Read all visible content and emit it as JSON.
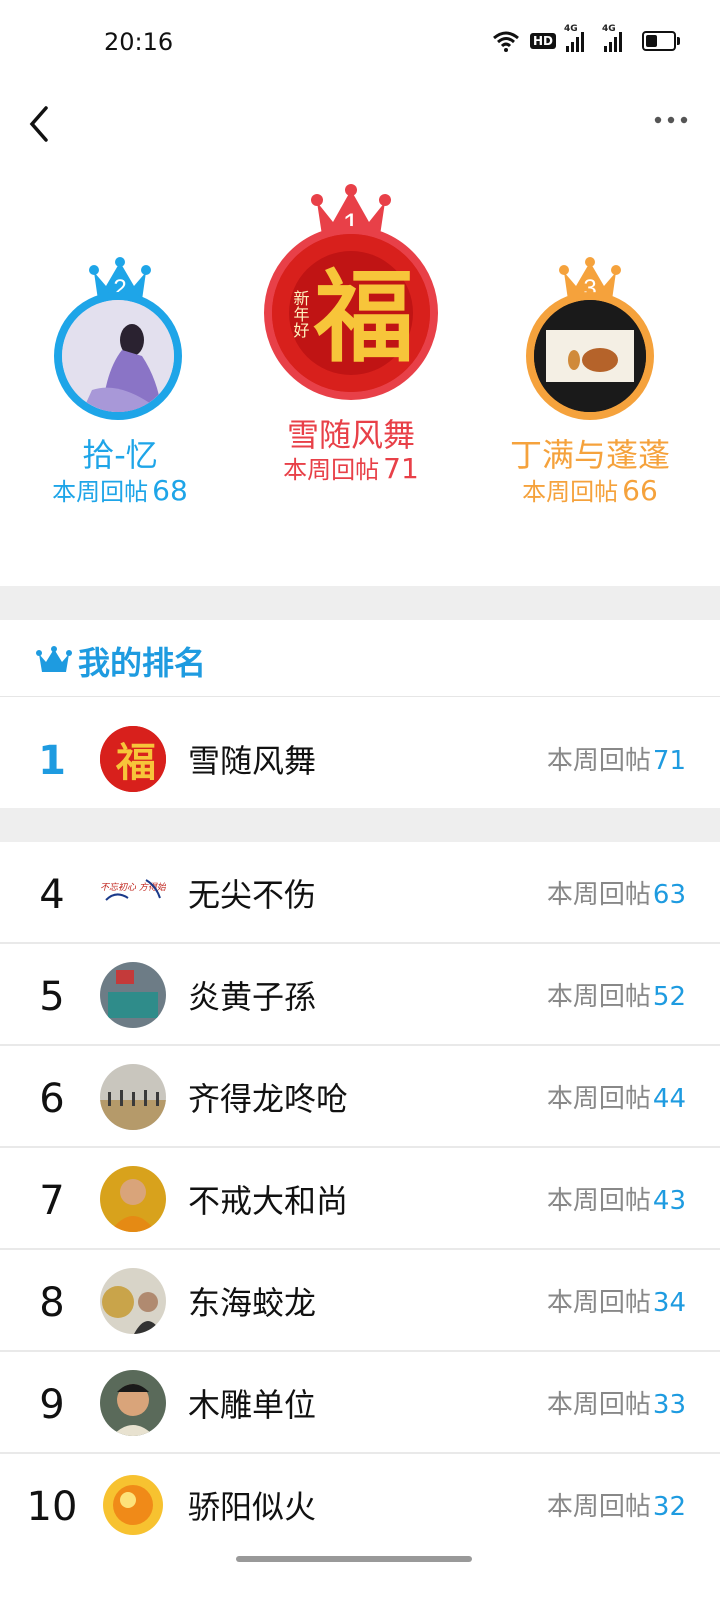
{
  "status_bar": {
    "time": "20:16",
    "icons": [
      "wifi-icon",
      "hd-badge",
      "signal-4g-icon",
      "signal-4g-icon",
      "battery-icon"
    ],
    "hd_label": "HD",
    "net_label": "4G"
  },
  "nav": {
    "back_icon": "chevron-left-icon",
    "more_icon": "more-horizontal-icon"
  },
  "stat_label": "本周回帖",
  "podium": [
    {
      "rank": "2",
      "name": "拾-忆",
      "count": "68",
      "color": "#1ea5e8"
    },
    {
      "rank": "1",
      "name": "雪随风舞",
      "count": "71",
      "color": "#e84048"
    },
    {
      "rank": "3",
      "name": "丁满与蓬蓬",
      "count": "66",
      "color": "#f5a23c"
    }
  ],
  "my_rank": {
    "title": "我的排名",
    "rank": "1",
    "name": "雪随风舞",
    "count": "71"
  },
  "list": [
    {
      "rank": "4",
      "name": "无尖不伤",
      "count": "63"
    },
    {
      "rank": "5",
      "name": "炎黄子孫",
      "count": "52"
    },
    {
      "rank": "6",
      "name": "齐得龙咚呛",
      "count": "44"
    },
    {
      "rank": "7",
      "name": "不戒大和尚",
      "count": "43"
    },
    {
      "rank": "8",
      "name": "东海蛟龙",
      "count": "34"
    },
    {
      "rank": "9",
      "name": "木雕单位",
      "count": "33"
    },
    {
      "rank": "10",
      "name": "骄阳似火",
      "count": "32"
    }
  ],
  "avatar_art": {
    "fu_char": "福",
    "fu_greeting": "新年好",
    "calligraphy_text": "不忘初心 方得始终"
  },
  "colors": {
    "accent": "#1e9be0",
    "gold": "#e8392c",
    "silver": "#1ea5e8",
    "bronze": "#f5a23c"
  }
}
